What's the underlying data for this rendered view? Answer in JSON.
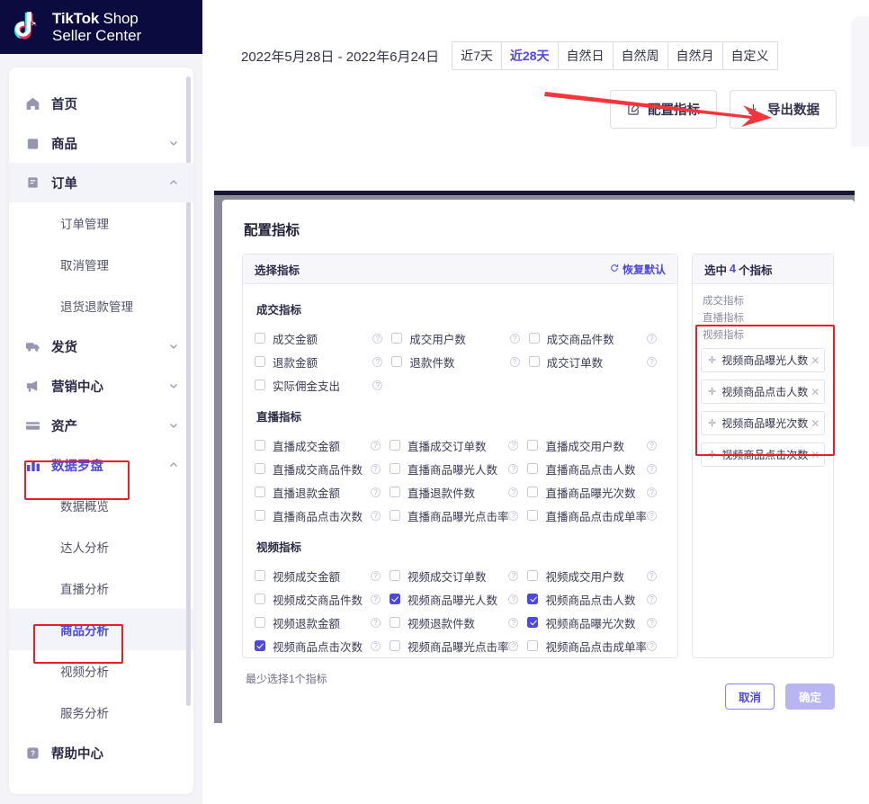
{
  "brand": {
    "line1_bold": "TikTok",
    "line1_light": " Shop",
    "line2": "Seller Center",
    "logo_icon": "tiktok-note-icon"
  },
  "sidebar": {
    "items": [
      {
        "label": "首页",
        "icon": "home-icon",
        "chevron": "",
        "state": "default"
      },
      {
        "label": "商品",
        "icon": "bag-icon",
        "chevron": "⌄",
        "state": "default"
      },
      {
        "label": "订单",
        "icon": "orders-icon",
        "chevron": "⌃",
        "state": "expanded"
      },
      {
        "label": "发货",
        "icon": "truck-icon",
        "chevron": "⌄",
        "state": "default"
      },
      {
        "label": "营销中心",
        "icon": "megaphone-icon",
        "chevron": "⌄",
        "state": "default"
      },
      {
        "label": "资产",
        "icon": "card-icon",
        "chevron": "⌄",
        "state": "default"
      },
      {
        "label": "数据罗盘",
        "icon": "bar-chart-icon",
        "chevron": "⌃",
        "state": "accent-expanded"
      },
      {
        "label": "帮助中心",
        "icon": "help-icon",
        "chevron": "",
        "state": "default"
      }
    ],
    "orders_children": [
      "订单管理",
      "取消管理",
      "退货退款管理"
    ],
    "dashboard_children": [
      {
        "label": "数据概览",
        "current": false
      },
      {
        "label": "达人分析",
        "current": false
      },
      {
        "label": "直播分析",
        "current": false
      },
      {
        "label": "商品分析",
        "current": true
      },
      {
        "label": "视频分析",
        "current": false
      },
      {
        "label": "服务分析",
        "current": false
      }
    ]
  },
  "toolbar": {
    "date_range": "2022年5月28日 - 2022年6月24日",
    "segments": [
      {
        "label": "近7天",
        "selected": false
      },
      {
        "label": "近28天",
        "selected": true
      },
      {
        "label": "自然日",
        "selected": false
      },
      {
        "label": "自然周",
        "selected": false
      },
      {
        "label": "自然月",
        "selected": false
      },
      {
        "label": "自定义",
        "selected": false
      }
    ],
    "config_button": "配置指标",
    "config_icon": "edit-square-icon",
    "export_button": "导出数据",
    "export_icon": "download-icon"
  },
  "annotation": {
    "arrow_color": "#f4363c",
    "highlight_color": "#ee1c25"
  },
  "modal": {
    "title": "配置指标",
    "left_panel_header": "选择指标",
    "restore_default": "恢复默认",
    "restore_icon": "refresh-icon",
    "right_panel_header_prefix": "选中",
    "right_panel_header_count": "4",
    "right_panel_header_suffix": "个指标",
    "hint": "最少选择1个指标",
    "cancel": "取消",
    "confirm": "确定",
    "groups": [
      {
        "title": "成交指标",
        "metrics": [
          {
            "label": "成交金额",
            "checked": false,
            "info": true
          },
          {
            "label": "成交用户数",
            "checked": false,
            "info": true
          },
          {
            "label": "成交商品件数",
            "checked": false,
            "info": true
          },
          {
            "label": "退款金额",
            "checked": false,
            "info": true
          },
          {
            "label": "退款件数",
            "checked": false,
            "info": true
          },
          {
            "label": "成交订单数",
            "checked": false,
            "info": true
          },
          {
            "label": "实际佣金支出",
            "checked": false,
            "info": true
          }
        ]
      },
      {
        "title": "直播指标",
        "metrics": [
          {
            "label": "直播成交金额",
            "checked": false,
            "info": true
          },
          {
            "label": "直播成交订单数",
            "checked": false,
            "info": true
          },
          {
            "label": "直播成交用户数",
            "checked": false,
            "info": true
          },
          {
            "label": "直播成交商品件数",
            "checked": false,
            "info": true
          },
          {
            "label": "直播商品曝光人数",
            "checked": false,
            "info": true
          },
          {
            "label": "直播商品点击人数",
            "checked": false,
            "info": true
          },
          {
            "label": "直播退款金额",
            "checked": false,
            "info": true
          },
          {
            "label": "直播退款件数",
            "checked": false,
            "info": true
          },
          {
            "label": "直播商品曝光次数",
            "checked": false,
            "info": true
          },
          {
            "label": "直播商品点击次数",
            "checked": false,
            "info": true
          },
          {
            "label": "直播商品曝光点击率",
            "checked": false,
            "info": true
          },
          {
            "label": "直播商品点击成单率",
            "checked": false,
            "info": true
          }
        ]
      },
      {
        "title": "视频指标",
        "metrics": [
          {
            "label": "视频成交金额",
            "checked": false,
            "info": true
          },
          {
            "label": "视频成交订单数",
            "checked": false,
            "info": true
          },
          {
            "label": "视频成交用户数",
            "checked": false,
            "info": true
          },
          {
            "label": "视频成交商品件数",
            "checked": false,
            "info": true
          },
          {
            "label": "视频商品曝光人数",
            "checked": true,
            "info": true
          },
          {
            "label": "视频商品点击人数",
            "checked": true,
            "info": true
          },
          {
            "label": "视频退款金额",
            "checked": false,
            "info": true
          },
          {
            "label": "视频退款件数",
            "checked": false,
            "info": true
          },
          {
            "label": "视频商品曝光次数",
            "checked": true,
            "info": true
          },
          {
            "label": "视频商品点击次数",
            "checked": true,
            "info": true
          },
          {
            "label": "视频商品曝光点击率",
            "checked": false,
            "info": true
          },
          {
            "label": "视频商品点击成单率",
            "checked": false,
            "info": true
          }
        ]
      }
    ],
    "selected_group_labels": [
      "成交指标",
      "直播指标",
      "视频指标"
    ],
    "selected_chips": [
      {
        "label": "视频商品曝光人数"
      },
      {
        "label": "视频商品点击人数"
      },
      {
        "label": "视频商品曝光次数"
      },
      {
        "label": "视频商品点击次数"
      }
    ]
  }
}
